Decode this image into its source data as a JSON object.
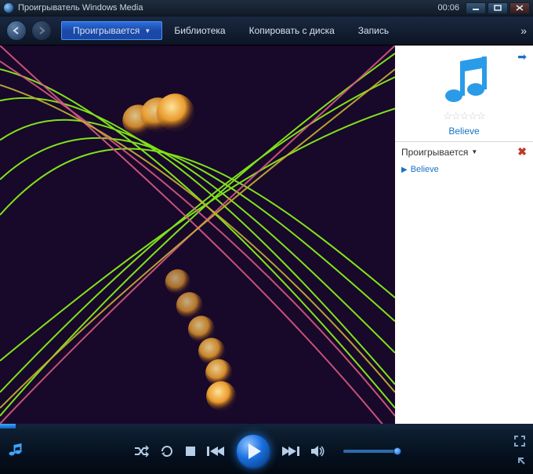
{
  "titlebar": {
    "app_name": "Проигрыватель Windows Media",
    "clock": "00:06"
  },
  "tabs": {
    "now_playing": "Проигрывается",
    "library": "Библиотека",
    "rip": "Копировать с диска",
    "burn": "Запись"
  },
  "sidepanel": {
    "track_title": "Believe",
    "playlist_header": "Проигрывается",
    "items": [
      {
        "label": "Believe"
      }
    ]
  },
  "icons": {
    "overflow": "»",
    "side_arrow": "➡",
    "delete": "✖",
    "stars": "☆☆☆☆☆"
  }
}
